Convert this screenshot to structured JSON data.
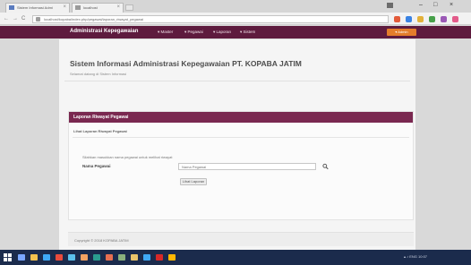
{
  "browser": {
    "tabs": [
      {
        "label": "Sistem Informasi Admi"
      },
      {
        "label": "localhost"
      }
    ],
    "window_controls": {
      "minimize": "–",
      "maximize": "□",
      "close": "×"
    },
    "nav": {
      "back": "←",
      "forward": "→",
      "reload": "C"
    },
    "address": "localhost/kopaba/index.php/pegawai/laporan_riwayat_pegawai",
    "extension_colors": [
      "#e35b3a",
      "#3a82e3",
      "#e3b13a",
      "#47a04a",
      "#9b59b6",
      "#e35b8a"
    ]
  },
  "app": {
    "brand": "Administrasi Kepegawaian",
    "menu": [
      {
        "label": "▾ Master"
      },
      {
        "label": "▾ Pegawai"
      },
      {
        "label": "▾ Laporan"
      },
      {
        "label": "▾ Sistem"
      }
    ],
    "user_button": "▾ Admin",
    "accent_color": "#5e1b3e"
  },
  "page": {
    "title": "Sistem Informasi Administrasi Kepegawaian PT. KOPABA JATIM",
    "subtitle": "Selamat datang di Sistem Informasi"
  },
  "panel": {
    "title": "Laporan Riwayat Pegawai",
    "breadcrumb": "Lihat Laporan Riwayat Pegawai",
    "instruction": "Silahkan masukkan nama pegawai untuk melihat riwayat",
    "name_label": "Nama Pegawai",
    "name_value": "Nama Pegawai",
    "submit_label": "Lihat Laporan",
    "header_color": "#7a2850"
  },
  "footer": {
    "text": "Copyright © 2018 KOPABA JATIM"
  },
  "taskbar": {
    "tray_text": "▴ ♪ ENG 10:07",
    "icon_colors": [
      "#7aa7ff",
      "#f2c14e",
      "#3fa9f5",
      "#e94b3c",
      "#5bc0eb",
      "#f4a261",
      "#2a9d8f",
      "#e76f51",
      "#8ab17d",
      "#e9c46a",
      "#3fa9f5",
      "#d62828",
      "#ffb703"
    ]
  }
}
